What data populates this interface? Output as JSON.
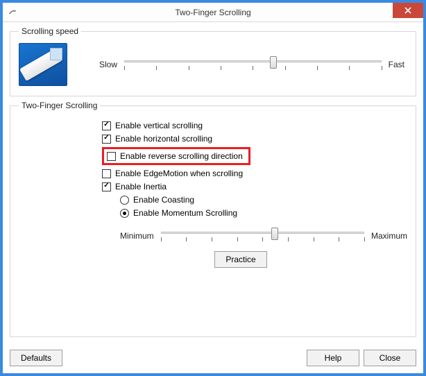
{
  "window": {
    "title": "Two-Finger Scrolling"
  },
  "speed": {
    "legend": "Scrolling speed",
    "min_label": "Slow",
    "max_label": "Fast",
    "value_pct": 58,
    "ticks": 9
  },
  "scrolling": {
    "legend": "Two-Finger Scrolling",
    "opts": {
      "vertical": {
        "label": "Enable vertical scrolling",
        "checked": true
      },
      "horizontal": {
        "label": "Enable horizontal scrolling",
        "checked": true
      },
      "reverse": {
        "label": "Enable reverse scrolling direction",
        "checked": false
      },
      "edgemotion": {
        "label": "Enable EdgeMotion when scrolling",
        "checked": false
      },
      "inertia": {
        "label": "Enable Inertia",
        "checked": true
      }
    },
    "inertia_mode": {
      "coasting": {
        "label": "Enable Coasting",
        "selected": false
      },
      "momentum": {
        "label": "Enable Momentum Scrolling",
        "selected": true
      }
    },
    "inertia_slider": {
      "min_label": "Minimum",
      "max_label": "Maximum",
      "value_pct": 56,
      "ticks": 9
    },
    "practice_label": "Practice"
  },
  "buttons": {
    "defaults": "Defaults",
    "help": "Help",
    "close": "Close"
  }
}
